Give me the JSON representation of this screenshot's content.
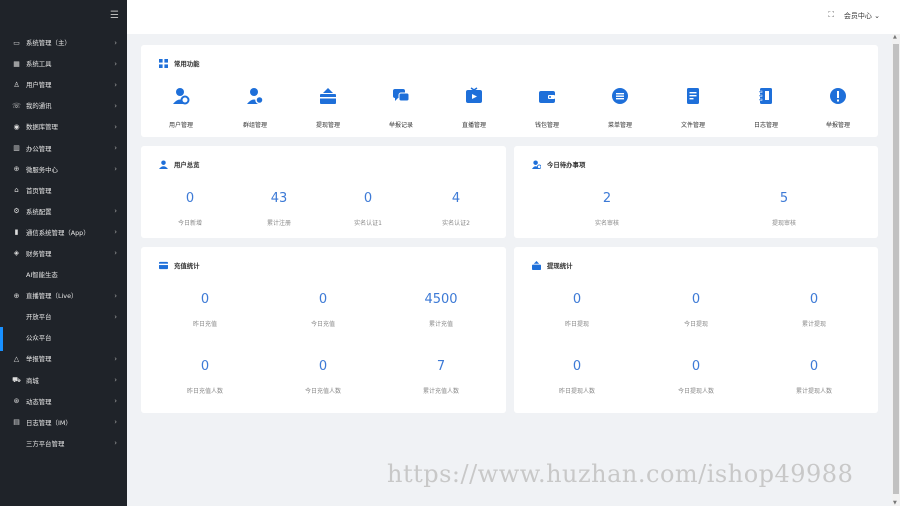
{
  "sidebar": {
    "items": [
      {
        "icon": "monitor-icon",
        "glyph": "▭",
        "label": "系统管理（主）",
        "arrow": true,
        "sub": false
      },
      {
        "icon": "tools-icon",
        "glyph": "▦",
        "label": "系统工具",
        "arrow": true,
        "sub": false
      },
      {
        "icon": "users-icon",
        "glyph": "♙",
        "label": "用户管理",
        "arrow": true,
        "sub": false
      },
      {
        "icon": "phone-icon",
        "glyph": "☏",
        "label": "我的通讯",
        "arrow": true,
        "sub": false
      },
      {
        "icon": "database-icon",
        "glyph": "◉",
        "label": "数据库管理",
        "arrow": true,
        "sub": false
      },
      {
        "icon": "office-icon",
        "glyph": "▥",
        "label": "办公管理",
        "arrow": true,
        "sub": false
      },
      {
        "icon": "globe-icon",
        "glyph": "⊕",
        "label": "微服务中心",
        "arrow": true,
        "sub": false
      },
      {
        "icon": "home-icon",
        "glyph": "⌂",
        "label": "首页管理",
        "arrow": false,
        "sub": false
      },
      {
        "icon": "settings-icon",
        "glyph": "⚙",
        "label": "系统配置",
        "arrow": true,
        "sub": false
      },
      {
        "icon": "bar-chart-icon",
        "glyph": "▮",
        "label": "通信系统管理（App）",
        "arrow": true,
        "sub": false
      },
      {
        "icon": "finance-icon",
        "glyph": "◈",
        "label": "财务管理",
        "arrow": true,
        "sub": false
      },
      {
        "icon": "",
        "glyph": "",
        "label": "AI智能生态",
        "arrow": false,
        "sub": true
      },
      {
        "icon": "live-icon",
        "glyph": "⊕",
        "label": "直播管理（Live）",
        "arrow": true,
        "sub": false
      },
      {
        "icon": "",
        "glyph": "",
        "label": "开放平台",
        "arrow": true,
        "sub": true
      },
      {
        "icon": "",
        "glyph": "",
        "label": "公众平台",
        "arrow": false,
        "sub": true
      },
      {
        "icon": "warning-icon",
        "glyph": "△",
        "label": "举报管理",
        "arrow": true,
        "sub": false
      },
      {
        "icon": "cart-icon",
        "glyph": "⛟",
        "label": "商城",
        "arrow": true,
        "sub": false
      },
      {
        "icon": "dynamic-icon",
        "glyph": "⊛",
        "label": "动态管理",
        "arrow": true,
        "sub": false
      },
      {
        "icon": "log-icon",
        "glyph": "▤",
        "label": "日志管理（IM）",
        "arrow": true,
        "sub": false
      },
      {
        "icon": "",
        "glyph": "",
        "label": "三方平台管理",
        "arrow": true,
        "sub": true
      }
    ]
  },
  "topbar": {
    "user_label": "会员中心",
    "fullscreen_icon": "fullscreen-icon"
  },
  "common_functions": {
    "title": "常用功能",
    "items": [
      {
        "label": "用户管理",
        "icon": "user-settings-icon"
      },
      {
        "label": "群组管理",
        "icon": "group-settings-icon"
      },
      {
        "label": "提现管理",
        "icon": "withdraw-box-icon"
      },
      {
        "label": "举报记录",
        "icon": "chat-bubbles-icon"
      },
      {
        "label": "直播管理",
        "icon": "tv-play-icon"
      },
      {
        "label": "钱包管理",
        "icon": "wallet-icon"
      },
      {
        "label": "菜单管理",
        "icon": "menu-list-icon"
      },
      {
        "label": "文件管理",
        "icon": "document-icon"
      },
      {
        "label": "日志管理",
        "icon": "notebook-icon"
      },
      {
        "label": "举报管理",
        "icon": "alert-icon"
      }
    ]
  },
  "user_overview": {
    "title": "用户总览",
    "stats": [
      {
        "value": "0",
        "label": "今日新增"
      },
      {
        "value": "43",
        "label": "累计注册"
      },
      {
        "value": "0",
        "label": "实名认证1"
      },
      {
        "value": "4",
        "label": "实名认证2"
      }
    ]
  },
  "todo": {
    "title": "今日待办事项",
    "stats": [
      {
        "value": "2",
        "label": "实名审核"
      },
      {
        "value": "5",
        "label": "提现审核"
      }
    ]
  },
  "recharge": {
    "title": "充值统计",
    "stats": [
      {
        "value": "0",
        "label": "昨日充值"
      },
      {
        "value": "0",
        "label": "今日充值"
      },
      {
        "value": "4500",
        "label": "累计充值"
      },
      {
        "value": "0",
        "label": "昨日充值人数"
      },
      {
        "value": "0",
        "label": "今日充值人数"
      },
      {
        "value": "7",
        "label": "累计充值人数"
      }
    ]
  },
  "withdraw": {
    "title": "提现统计",
    "stats": [
      {
        "value": "0",
        "label": "昨日提现"
      },
      {
        "value": "0",
        "label": "今日提现"
      },
      {
        "value": "0",
        "label": "累计提现"
      },
      {
        "value": "0",
        "label": "昨日提现人数"
      },
      {
        "value": "0",
        "label": "今日提现人数"
      },
      {
        "value": "0",
        "label": "累计提现人数"
      }
    ]
  },
  "watermark": "https://www.huzhan.com/ishop49988",
  "colors": {
    "sidebar_bg": "#1f2329",
    "accent": "#1e6fd9",
    "value_text": "#3d7ad6"
  }
}
